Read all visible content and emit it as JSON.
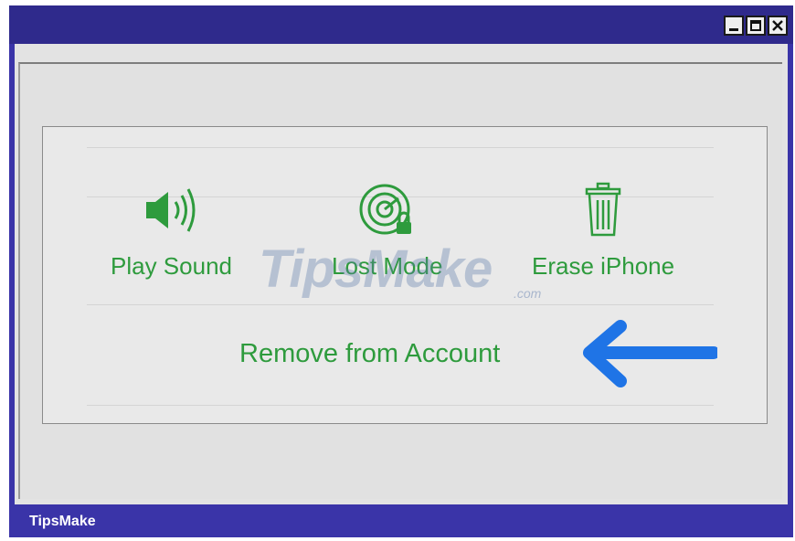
{
  "window": {
    "controls": [
      "minimize-icon",
      "maximize-icon",
      "close-icon"
    ]
  },
  "actions": [
    {
      "label": "Play Sound",
      "icon": "speaker-icon"
    },
    {
      "label": "Lost Mode",
      "icon": "radar-lock-icon"
    },
    {
      "label": "Erase iPhone",
      "icon": "trash-icon"
    }
  ],
  "remove_action": {
    "label": "Remove from Account",
    "pointer": "arrow-left-icon"
  },
  "watermark": {
    "text": "TipsMake",
    "suffix": ".com"
  },
  "statusbar": {
    "text": "TipsMake"
  },
  "colors": {
    "title_bar": "#2f2a8c",
    "frame": "#3a34a8",
    "action_green": "#2e9b3d",
    "arrow_blue": "#1f74e6"
  }
}
